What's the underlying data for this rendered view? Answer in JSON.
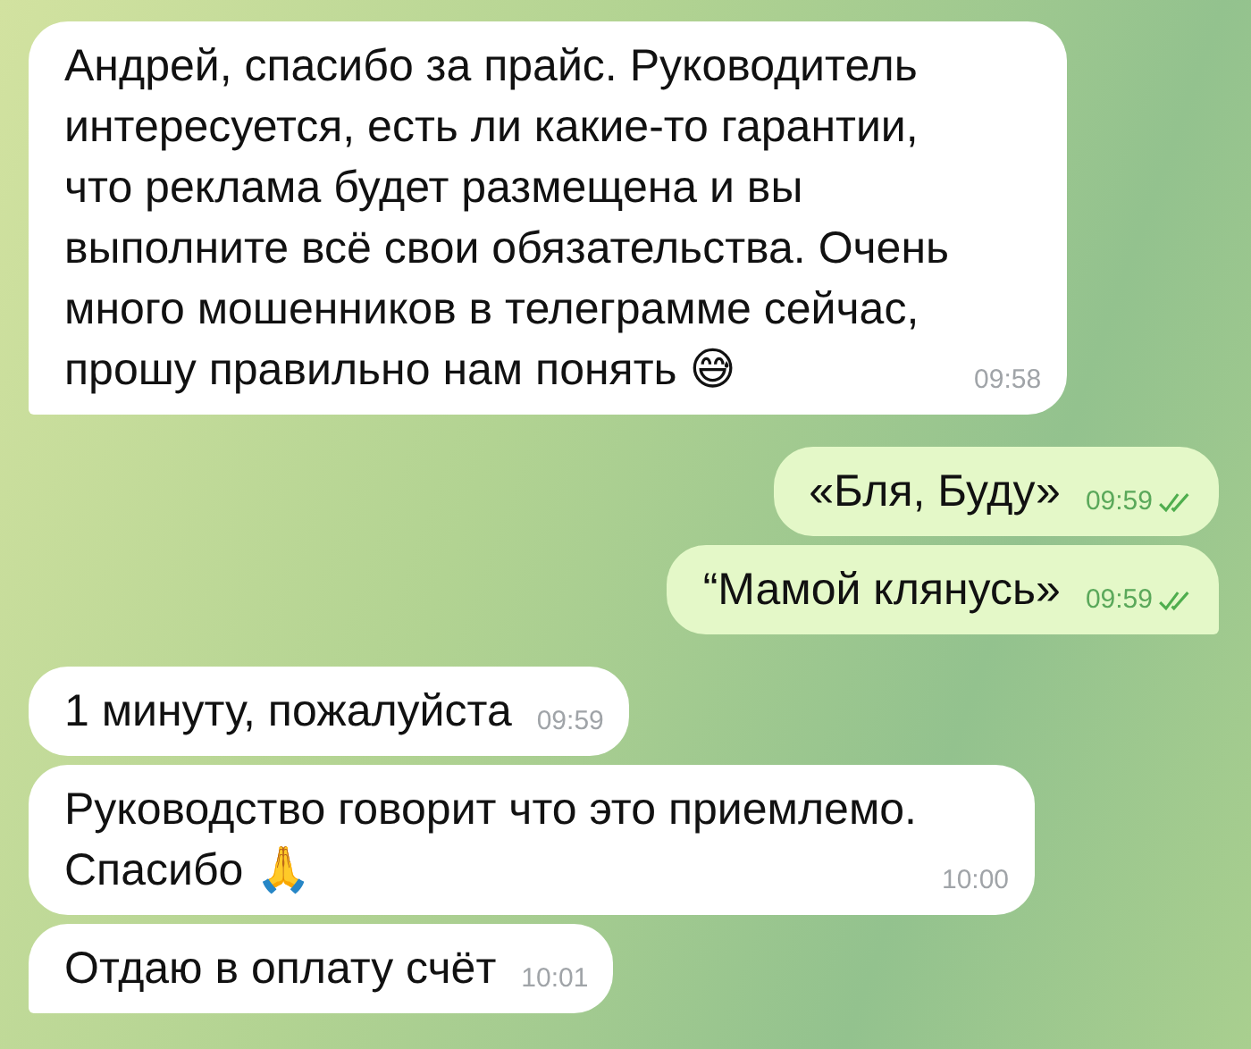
{
  "messages": [
    {
      "kind": "incoming",
      "text": "Андрей, спасибо за прайс. Руководитель\nинтересуется, есть ли какие-то гарантии,\nчто реклама будет размещена и вы\nвыполните всё свои обязательства. Очень\nмного мошенников в телеграмме сейчас,\nпрошу правильно нам понять 😅",
      "time": "09:58",
      "tail": true
    },
    {
      "kind": "outgoing",
      "text": "«Бля, Буду»",
      "time": "09:59",
      "read": true,
      "tail": false
    },
    {
      "kind": "outgoing",
      "text": "“Мамой клянусь»",
      "time": "09:59",
      "read": true,
      "tail": true
    },
    {
      "kind": "incoming",
      "text": "1 минуту, пожалуйста",
      "time": "09:59",
      "tail": false
    },
    {
      "kind": "incoming",
      "text": "Руководство говорит что это приемлемо.\nСпасибо 🙏",
      "time": "10:00",
      "tail": false
    },
    {
      "kind": "incoming",
      "text": "Отдаю в оплату счёт",
      "time": "10:01",
      "tail": true
    }
  ]
}
